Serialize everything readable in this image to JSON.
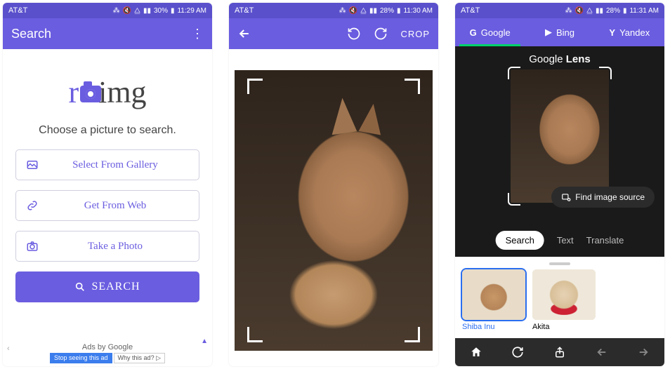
{
  "colors": {
    "accent": "#6a5de0",
    "statusbar": "#5a50cc",
    "select": "#2a6ef0",
    "lens_bg": "#1a1a1a"
  },
  "phone1": {
    "status": {
      "carrier": "AT&T",
      "battery": "30%",
      "time": "11:29 AM"
    },
    "appbar": {
      "title": "Search",
      "menu_name": "more-menu-icon"
    },
    "logo": {
      "text_prefix": "r",
      "text_rest": "img"
    },
    "prompt": "Choose a picture to search.",
    "options": [
      {
        "icon": "gallery-icon",
        "label": "Select From Gallery"
      },
      {
        "icon": "web-icon",
        "label": "Get From Web"
      },
      {
        "icon": "camera-icon",
        "label": "Take a Photo"
      }
    ],
    "search_button": "SEARCH",
    "ads": {
      "label": "Ads by Google",
      "stop": "Stop seeing this ad",
      "why": "Why this ad? ▷"
    }
  },
  "phone2": {
    "status": {
      "carrier": "AT&T",
      "battery": "28%",
      "time": "11:30 AM"
    },
    "appbar": {
      "back_name": "back-icon",
      "rotate_left_name": "rotate-left-icon",
      "rotate_right_name": "rotate-right-icon",
      "crop_label": "CROP"
    },
    "photo": {
      "subject": "dog-shiba",
      "crop_frame": "crop-frame"
    }
  },
  "phone3": {
    "status": {
      "carrier": "AT&T",
      "battery": "28%",
      "time": "11:31 AM"
    },
    "engine_tabs": [
      {
        "name": "Google",
        "active": true
      },
      {
        "name": "Bing",
        "active": false
      },
      {
        "name": "Yandex",
        "active": false
      }
    ],
    "lens": {
      "title_prefix": "Google",
      "title_suffix": "Lens",
      "find_source_label": "Find image source",
      "mode_tabs": [
        {
          "label": "Search",
          "active": true
        },
        {
          "label": "Text",
          "active": false
        },
        {
          "label": "Translate",
          "active": false
        }
      ]
    },
    "results": [
      {
        "label": "Shiba Inu",
        "selected": true
      },
      {
        "label": "Akita",
        "selected": false
      }
    ],
    "bottom_nav": {
      "home": "home-icon",
      "refresh": "refresh-icon",
      "share": "share-icon",
      "back": "nav-back-icon",
      "forward": "nav-forward-icon"
    }
  }
}
